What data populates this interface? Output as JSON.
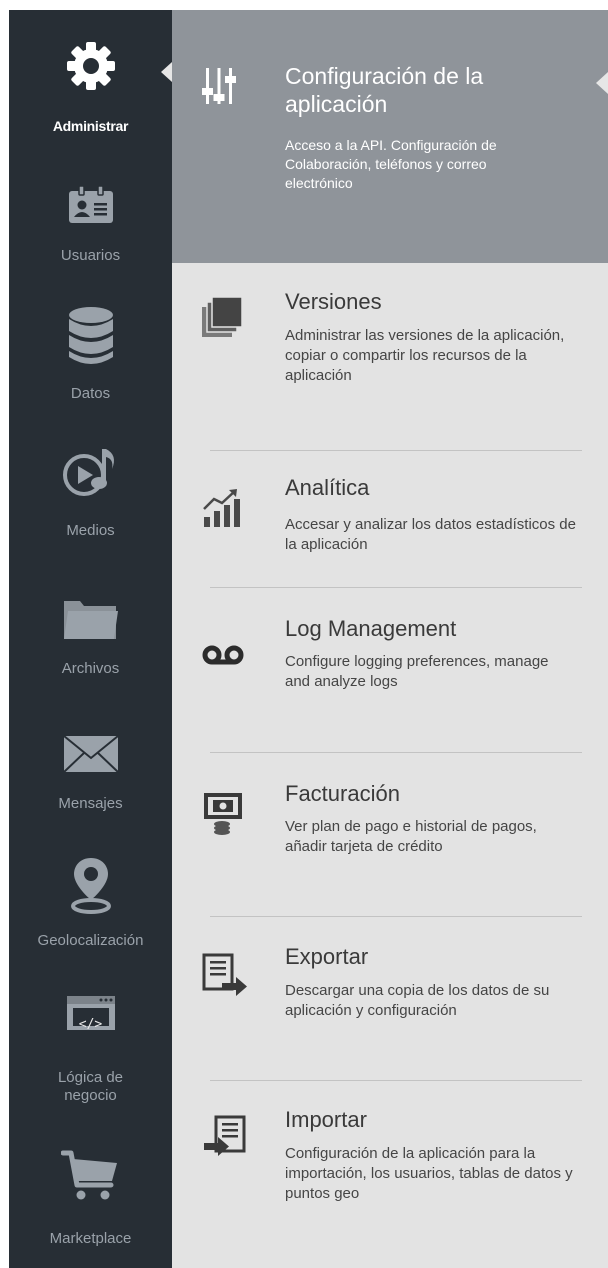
{
  "sidebar": {
    "items": [
      {
        "label": "Administrar",
        "icon": "gear-icon",
        "active": true
      },
      {
        "label": "Usuarios",
        "icon": "id-card-icon"
      },
      {
        "label": "Datos",
        "icon": "database-icon"
      },
      {
        "label": "Medios",
        "icon": "media-play-icon"
      },
      {
        "label": "Archivos",
        "icon": "folder-icon"
      },
      {
        "label": "Mensajes",
        "icon": "envelope-icon"
      },
      {
        "label": "Geolocalización",
        "icon": "map-pin-icon"
      },
      {
        "label": "Lógica de negocio",
        "icon": "code-window-icon"
      },
      {
        "label": "Marketplace",
        "icon": "cart-icon"
      }
    ]
  },
  "panel": {
    "items": [
      {
        "title": "Configuración de la aplicación",
        "desc": "Acceso a la API. Configuración de Colaboración, teléfonos y correo electrónico",
        "icon": "sliders-icon",
        "active": true
      },
      {
        "title": "Versiones",
        "desc": "Administrar las versiones de la aplicación, copiar o compartir los recursos de la aplicación",
        "icon": "layers-icon"
      },
      {
        "title": "Analítica",
        "desc": "Accesar y analizar los datos estadísticos de la aplicación",
        "icon": "chart-growth-icon"
      },
      {
        "title": "Log Management",
        "desc": "Configure logging preferences, manage and analyze logs",
        "icon": "voicemail-icon"
      },
      {
        "title": "Facturación",
        "desc": "Ver plan de pago e historial de pagos, añadir tarjeta de crédito",
        "icon": "billing-icon"
      },
      {
        "title": "Exportar",
        "desc": "Descargar una copia de los datos de su aplicación y configuración",
        "icon": "export-icon"
      },
      {
        "title": "Importar",
        "desc": "Configuración de la aplicación para la importación, los usuarios, tablas de datos y puntos geo",
        "icon": "import-icon"
      }
    ]
  },
  "colors": {
    "sidebar_bg": "#272e35",
    "panel_bg": "#e3e3e3",
    "active_item_bg": "#8f949a",
    "icon_gray": "#9aa2aa"
  }
}
